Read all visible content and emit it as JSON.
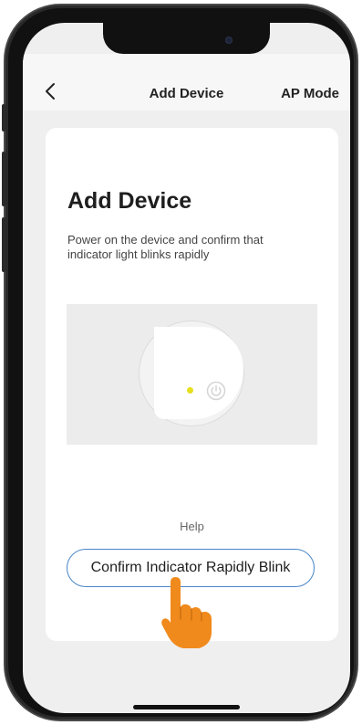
{
  "nav": {
    "back_icon": "chevron-left-icon",
    "title": "Add Device",
    "action": "AP Mode"
  },
  "card": {
    "title": "Add Device",
    "instruction": "Power on the device and confirm that indicator light blinks rapidly",
    "illustration": {
      "indicator_color": "#e6e01b",
      "power_icon": "power-icon"
    },
    "help_label": "Help",
    "confirm_button_label": "Confirm Indicator Rapidly Blink"
  },
  "colors": {
    "accent": "#4a86c9",
    "pointer": "#f08a1c"
  }
}
